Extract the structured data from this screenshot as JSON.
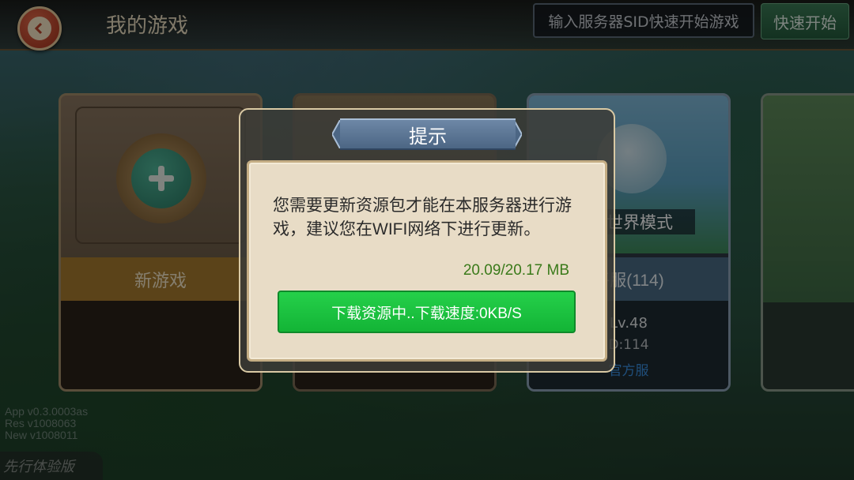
{
  "header": {
    "title": "我的游戏",
    "sid_input_placeholder": "输入服务器SID快速开始游戏",
    "quick_start_label": "快速开始"
  },
  "cards": {
    "new_game_label": "新游戏",
    "world_mode_label": "世界模式",
    "server_label": "平服(114)",
    "level_text": "Lv.48",
    "sid_text": "D:114",
    "official_text": "官方服"
  },
  "version": {
    "app": "App  v0.3.0003as",
    "res": "Res  v1008063",
    "new": "New v1008011"
  },
  "preview_tag": "先行体验版",
  "dialog": {
    "title": "提示",
    "message": "您需要更新资源包才能在本服务器进行游戏，建议您在WIFI网络下进行更新。",
    "progress": "20.09/20.17 MB",
    "download_label": "下载资源中..下载速度:0KB/S"
  },
  "colors": {
    "download_button": "#13b436",
    "progress_text": "#3a7a1a",
    "new_card_band": "#a77b2f",
    "official_link": "#3a8fe0"
  }
}
